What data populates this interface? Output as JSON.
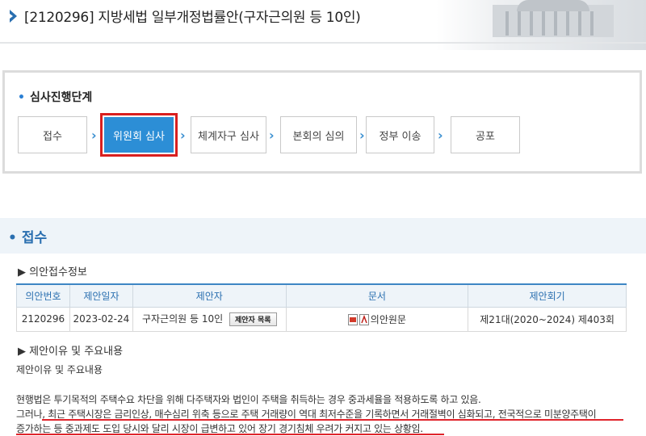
{
  "header": {
    "title": "[2120296] 지방세법 일부개정법률안(구자근의원 등 10인)"
  },
  "progress": {
    "title": "심사진행단계",
    "steps": [
      {
        "label": "접수",
        "active": false
      },
      {
        "label": "위원회 심사",
        "active": true
      },
      {
        "label": "체계자구 심사",
        "active": false
      },
      {
        "label": "본회의 심의",
        "active": false
      },
      {
        "label": "정부 이송",
        "active": false
      },
      {
        "label": "공포",
        "active": false
      }
    ]
  },
  "section": {
    "title": "접수"
  },
  "receipt_info": {
    "heading": "▶ 의안접수정보",
    "columns": [
      "의안번호",
      "제안일자",
      "제안자",
      "문서",
      "제안회기"
    ],
    "row": {
      "bill_no": "2120296",
      "date": "2023-02-24",
      "proposer": "구자근의원 등 10인",
      "proposer_button": "제안자 목록",
      "document": "의안원문",
      "session": "제21대(2020~2024) 제403회"
    }
  },
  "reason": {
    "heading": "▶ 제안이유 및 주요내용",
    "subheading": "제안이유 및 주요내용",
    "lines": [
      "현행법은 투기목적의 주택수요 차단을 위해 다주택자와 법인이 주택을 취득하는 경우 중과세율을 적용하도록 하고 있음.",
      "그러나, 최근 주택시장은 금리인상, 매수심리 위축 등으로 주택 거래량이 역대 최저수준을 기록하면서 거래절벽이 심화되고, 전국적으로 미분양주택이",
      "증가하는 등 중과제도 도입 당시와 달리 시장이 급변하고 있어 장기 경기침체 우려가 커지고 있는 상황임."
    ]
  },
  "colors": {
    "accent_blue": "#2c8ed6",
    "highlight_red": "#d91f1f"
  }
}
